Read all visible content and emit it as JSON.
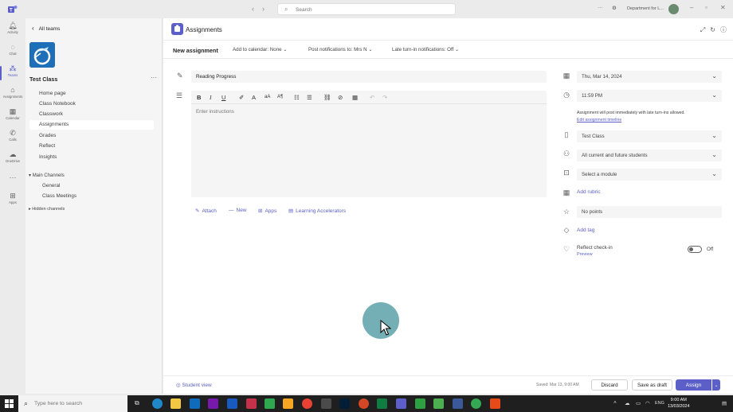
{
  "titlebar": {
    "search_placeholder": "Search",
    "org_name": "Department for L...",
    "more": "···"
  },
  "rail": [
    {
      "icon": "activity-icon",
      "label": "Activity"
    },
    {
      "icon": "chat-icon",
      "label": "Chat"
    },
    {
      "icon": "teams-icon",
      "label": "Teams"
    },
    {
      "icon": "assignments-icon",
      "label": "Assignments"
    },
    {
      "icon": "calendar-icon",
      "label": "Calendar"
    },
    {
      "icon": "calls-icon",
      "label": "Calls"
    },
    {
      "icon": "onedrive-icon",
      "label": "OneDrive"
    },
    {
      "icon": "more-icon",
      "label": ""
    },
    {
      "icon": "apps-icon",
      "label": "Apps"
    }
  ],
  "team_panel": {
    "back_label": "All teams",
    "team_name": "Test Class",
    "more": "···",
    "channels": [
      "Home page",
      "Class Notebook",
      "Classwork",
      "Assignments",
      "Grades",
      "Reflect",
      "Insights"
    ],
    "main_channels_label": "Main Channels",
    "sub_channels": [
      "General",
      "Class Meetings"
    ],
    "hidden_channels_label": "Hidden channels"
  },
  "header": {
    "title": "Assignments"
  },
  "subbar": {
    "title": "New assignment",
    "add_to_calendar": "Add to calendar: None",
    "post_notifications": "Post notifications to: Mrs N",
    "late_turn_in": "Late turn-in notifications: Off"
  },
  "form": {
    "title_value": "Reading Progress",
    "instructions_placeholder": "Enter instructions",
    "attach": "Attach",
    "new": "New",
    "apps": "Apps",
    "learning_accelerators": "Learning Accelerators"
  },
  "details": {
    "due_date": "Thu, Mar 14, 2024",
    "due_time": "11:59 PM",
    "note": "Assignment will post immediately with late turn-ins allowed.",
    "edit_timeline": "Edit assignment timeline",
    "class": "Test Class",
    "students": "All current and future students",
    "module": "Select a module",
    "add_rubric": "Add rubric",
    "points": "No points",
    "add_tag": "Add tag",
    "reflect_label": "Reflect check-in",
    "reflect_preview": "Preview",
    "toggle_state": "Off"
  },
  "footer": {
    "student_view": "Student view",
    "saved": "Saved: Mar 13, 9:00 AM",
    "discard": "Discard",
    "save_draft": "Save as draft",
    "assign": "Assign"
  },
  "taskbar": {
    "search_placeholder": "Type here to search",
    "lang": "ENG",
    "time": "9:00 AM",
    "date": "13/03/2024"
  },
  "colors": {
    "accent": "#5b5fc7",
    "taskbar": "#1f1f1f",
    "cursor_highlight": "#5ca1a8"
  }
}
